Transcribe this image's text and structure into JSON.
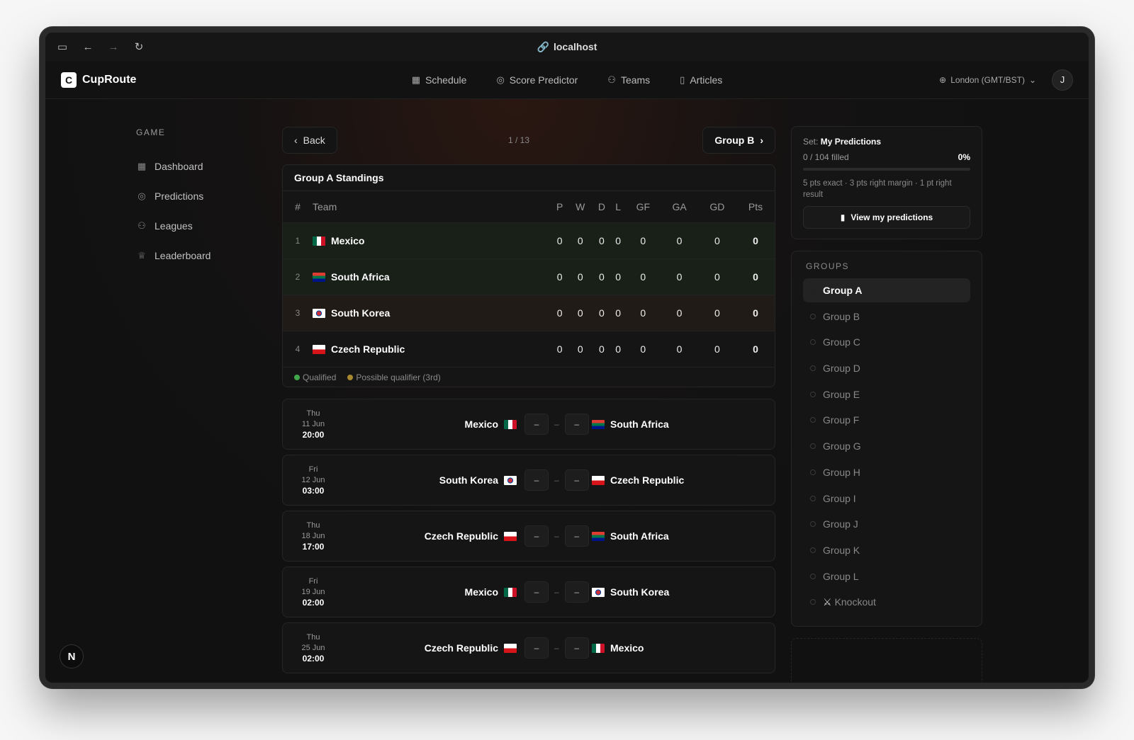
{
  "browser": {
    "url": "localhost"
  },
  "app": {
    "name": "CupRoute",
    "logo_letter": "C"
  },
  "nav": [
    {
      "label": "Schedule",
      "icon": "calendar-icon"
    },
    {
      "label": "Score Predictor",
      "icon": "ball-icon"
    },
    {
      "label": "Teams",
      "icon": "users-icon"
    },
    {
      "label": "Articles",
      "icon": "book-icon"
    }
  ],
  "timezone": "London (GMT/BST)",
  "user_initial": "J",
  "sidebar": {
    "heading": "GAME",
    "items": [
      "Dashboard",
      "Predictions",
      "Leagues",
      "Leaderboard"
    ]
  },
  "pager": {
    "back": "Back",
    "count": "1 / 13",
    "next": "Group B"
  },
  "standings": {
    "title": "Group A Standings",
    "columns": [
      "#",
      "Team",
      "P",
      "W",
      "D",
      "L",
      "GF",
      "GA",
      "GD",
      "Pts"
    ],
    "rows": [
      {
        "rank": "1",
        "team": "Mexico",
        "stats": [
          "0",
          "0",
          "0",
          "0",
          "0",
          "0",
          "0",
          "0"
        ]
      },
      {
        "rank": "2",
        "team": "South Africa",
        "stats": [
          "0",
          "0",
          "0",
          "0",
          "0",
          "0",
          "0",
          "0"
        ]
      },
      {
        "rank": "3",
        "team": "South Korea",
        "stats": [
          "0",
          "0",
          "0",
          "0",
          "0",
          "0",
          "0",
          "0"
        ]
      },
      {
        "rank": "4",
        "team": "Czech Republic",
        "stats": [
          "0",
          "0",
          "0",
          "0",
          "0",
          "0",
          "0",
          "0"
        ]
      }
    ],
    "legend": {
      "qualified": "Qualified",
      "possible": "Possible qualifier (3rd)"
    }
  },
  "matches": [
    {
      "day": "Thu",
      "date": "11 Jun",
      "time": "20:00",
      "home": "Mexico",
      "away": "South Africa",
      "home_score": "–",
      "away_score": "–"
    },
    {
      "day": "Fri",
      "date": "12 Jun",
      "time": "03:00",
      "home": "South Korea",
      "away": "Czech Republic",
      "home_score": "–",
      "away_score": "–"
    },
    {
      "day": "Thu",
      "date": "18 Jun",
      "time": "17:00",
      "home": "Czech Republic",
      "away": "South Africa",
      "home_score": "–",
      "away_score": "–"
    },
    {
      "day": "Fri",
      "date": "19 Jun",
      "time": "02:00",
      "home": "Mexico",
      "away": "South Korea",
      "home_score": "–",
      "away_score": "–"
    },
    {
      "day": "Thu",
      "date": "25 Jun",
      "time": "02:00",
      "home": "Czech Republic",
      "away": "Mexico",
      "home_score": "–",
      "away_score": "–"
    }
  ],
  "predictions": {
    "set_label": "Set:",
    "set_name": "My Predictions",
    "filled": "0 / 104 filled",
    "percent": "0%",
    "progress_fraction": 0,
    "rules": "5 pts exact · 3 pts right margin · 1 pt right result",
    "view_button": "View my predictions"
  },
  "groups": {
    "heading": "GROUPS",
    "items": [
      "Group A",
      "Group B",
      "Group C",
      "Group D",
      "Group E",
      "Group F",
      "Group G",
      "Group H",
      "Group I",
      "Group J",
      "Group K",
      "Group L",
      "Knockout"
    ],
    "active": "Group A"
  },
  "devtools_badge": "N"
}
